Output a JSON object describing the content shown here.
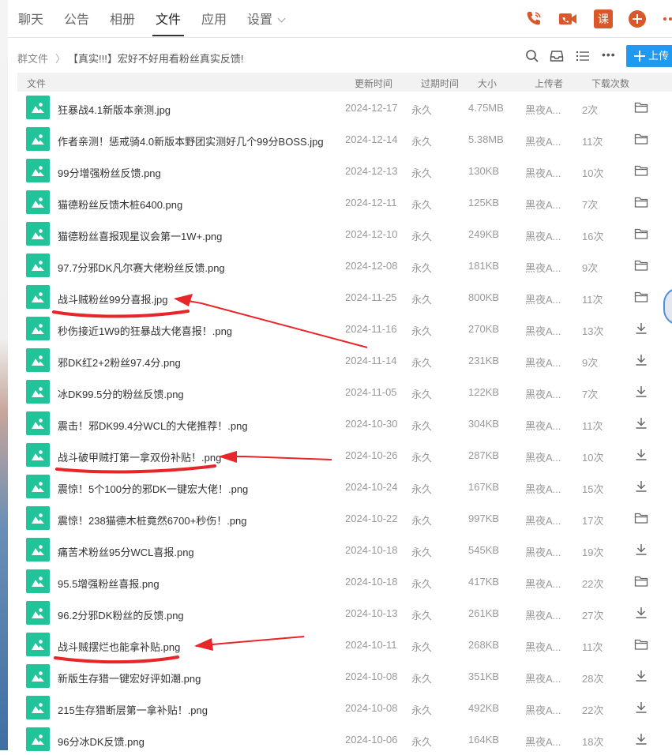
{
  "nav": {
    "tabs": [
      "聊天",
      "公告",
      "相册",
      "文件",
      "应用",
      "设置"
    ],
    "active_tab": "文件",
    "course_badge": "课"
  },
  "breadcrumb": {
    "root": "群文件",
    "separator": "〉",
    "current": "【真实!!!】宏好不好用看粉丝真实反馈!"
  },
  "toolbar": {
    "upload_label": "上传",
    "more_label": "•••"
  },
  "table": {
    "headers": [
      "文件",
      "更新时间",
      "过期时间",
      "大小",
      "上传者",
      "下载次数"
    ],
    "rows": [
      {
        "name": "狂暴战4.1新版本亲测.jpg",
        "date": "2024-12-17",
        "expire": "永久",
        "size": "4.75MB",
        "uploader": "黑夜A...",
        "downloads": "2次",
        "action": "folder-icon"
      },
      {
        "name": "作者亲测！惩戒骑4.0新版本野团实测好几个99分BOSS.jpg",
        "date": "2024-12-14",
        "expire": "永久",
        "size": "5.38MB",
        "uploader": "黑夜A...",
        "downloads": "11次",
        "action": "folder-icon"
      },
      {
        "name": "99分增强粉丝反馈.png",
        "date": "2024-12-13",
        "expire": "永久",
        "size": "130KB",
        "uploader": "黑夜A...",
        "downloads": "10次",
        "action": "folder-icon"
      },
      {
        "name": "猫德粉丝反馈木桩6400.png",
        "date": "2024-12-11",
        "expire": "永久",
        "size": "125KB",
        "uploader": "黑夜A...",
        "downloads": "7次",
        "action": "folder-icon"
      },
      {
        "name": "猫德粉丝喜报观星议会第一1W+.png",
        "date": "2024-12-10",
        "expire": "永久",
        "size": "249KB",
        "uploader": "黑夜A...",
        "downloads": "16次",
        "action": "folder-icon"
      },
      {
        "name": "97.7分邪DK凡尔赛大佬粉丝反馈.png",
        "date": "2024-12-08",
        "expire": "永久",
        "size": "181KB",
        "uploader": "黑夜A...",
        "downloads": "9次",
        "action": "folder-icon"
      },
      {
        "name": "战斗贼粉丝99分喜报.jpg",
        "date": "2024-11-25",
        "expire": "永久",
        "size": "800KB",
        "uploader": "黑夜A...",
        "downloads": "11次",
        "action": "folder-icon"
      },
      {
        "name": "秒伤接近1W9的狂暴战大佬喜报！.png",
        "date": "2024-11-16",
        "expire": "永久",
        "size": "270KB",
        "uploader": "黑夜A...",
        "downloads": "13次",
        "action": "download-icon"
      },
      {
        "name": "邪DK红2+2粉丝97.4分.png",
        "date": "2024-11-14",
        "expire": "永久",
        "size": "231KB",
        "uploader": "黑夜A...",
        "downloads": "9次",
        "action": "download-icon"
      },
      {
        "name": "冰DK99.5分的粉丝反馈.png",
        "date": "2024-11-05",
        "expire": "永久",
        "size": "122KB",
        "uploader": "黑夜A...",
        "downloads": "7次",
        "action": "download-icon"
      },
      {
        "name": "震击！邪DK99.4分WCL的大佬推荐！.png",
        "date": "2024-10-30",
        "expire": "永久",
        "size": "304KB",
        "uploader": "黑夜A...",
        "downloads": "11次",
        "action": "download-icon"
      },
      {
        "name": "战斗破甲贼打第一拿双份补贴！.png",
        "date": "2024-10-26",
        "expire": "永久",
        "size": "287KB",
        "uploader": "黑夜A...",
        "downloads": "10次",
        "action": "download-icon"
      },
      {
        "name": "震惊！5个100分的邪DK一键宏大佬！.png",
        "date": "2024-10-24",
        "expire": "永久",
        "size": "167KB",
        "uploader": "黑夜A...",
        "downloads": "15次",
        "action": "download-icon"
      },
      {
        "name": "震惊！238猫德木桩竟然6700+秒伤！.png",
        "date": "2024-10-22",
        "expire": "永久",
        "size": "997KB",
        "uploader": "黑夜A...",
        "downloads": "17次",
        "action": "folder-icon"
      },
      {
        "name": "痛苦术粉丝95分WCL喜报.png",
        "date": "2024-10-18",
        "expire": "永久",
        "size": "545KB",
        "uploader": "黑夜A...",
        "downloads": "19次",
        "action": "download-icon"
      },
      {
        "name": "95.5增强粉丝喜报.png",
        "date": "2024-10-18",
        "expire": "永久",
        "size": "417KB",
        "uploader": "黑夜A...",
        "downloads": "22次",
        "action": "folder-icon"
      },
      {
        "name": "96.2分邪DK粉丝的反馈.png",
        "date": "2024-10-13",
        "expire": "永久",
        "size": "261KB",
        "uploader": "黑夜A...",
        "downloads": "27次",
        "action": "download-icon"
      },
      {
        "name": "战斗贼摆烂也能拿补贴.png",
        "date": "2024-10-11",
        "expire": "永久",
        "size": "268KB",
        "uploader": "黑夜A...",
        "downloads": "11次",
        "action": "folder-icon"
      },
      {
        "name": "新版生存猎一键宏好评如潮.png",
        "date": "2024-10-08",
        "expire": "永久",
        "size": "351KB",
        "uploader": "黑夜A...",
        "downloads": "28次",
        "action": "download-icon"
      },
      {
        "name": "215生存猎断层第一拿补贴！.png",
        "date": "2024-10-08",
        "expire": "永久",
        "size": "492KB",
        "uploader": "黑夜A...",
        "downloads": "22次",
        "action": "download-icon"
      },
      {
        "name": "96分冰DK反馈.png",
        "date": "2024-10-06",
        "expire": "永久",
        "size": "164KB",
        "uploader": "黑夜A...",
        "downloads": "18次",
        "action": "download-icon"
      }
    ]
  },
  "colors": {
    "accent": "#1e9bf0",
    "icon_orange": "#d9582b",
    "thumb_green": "#22c29a",
    "annotation_red": "#e8262a"
  }
}
